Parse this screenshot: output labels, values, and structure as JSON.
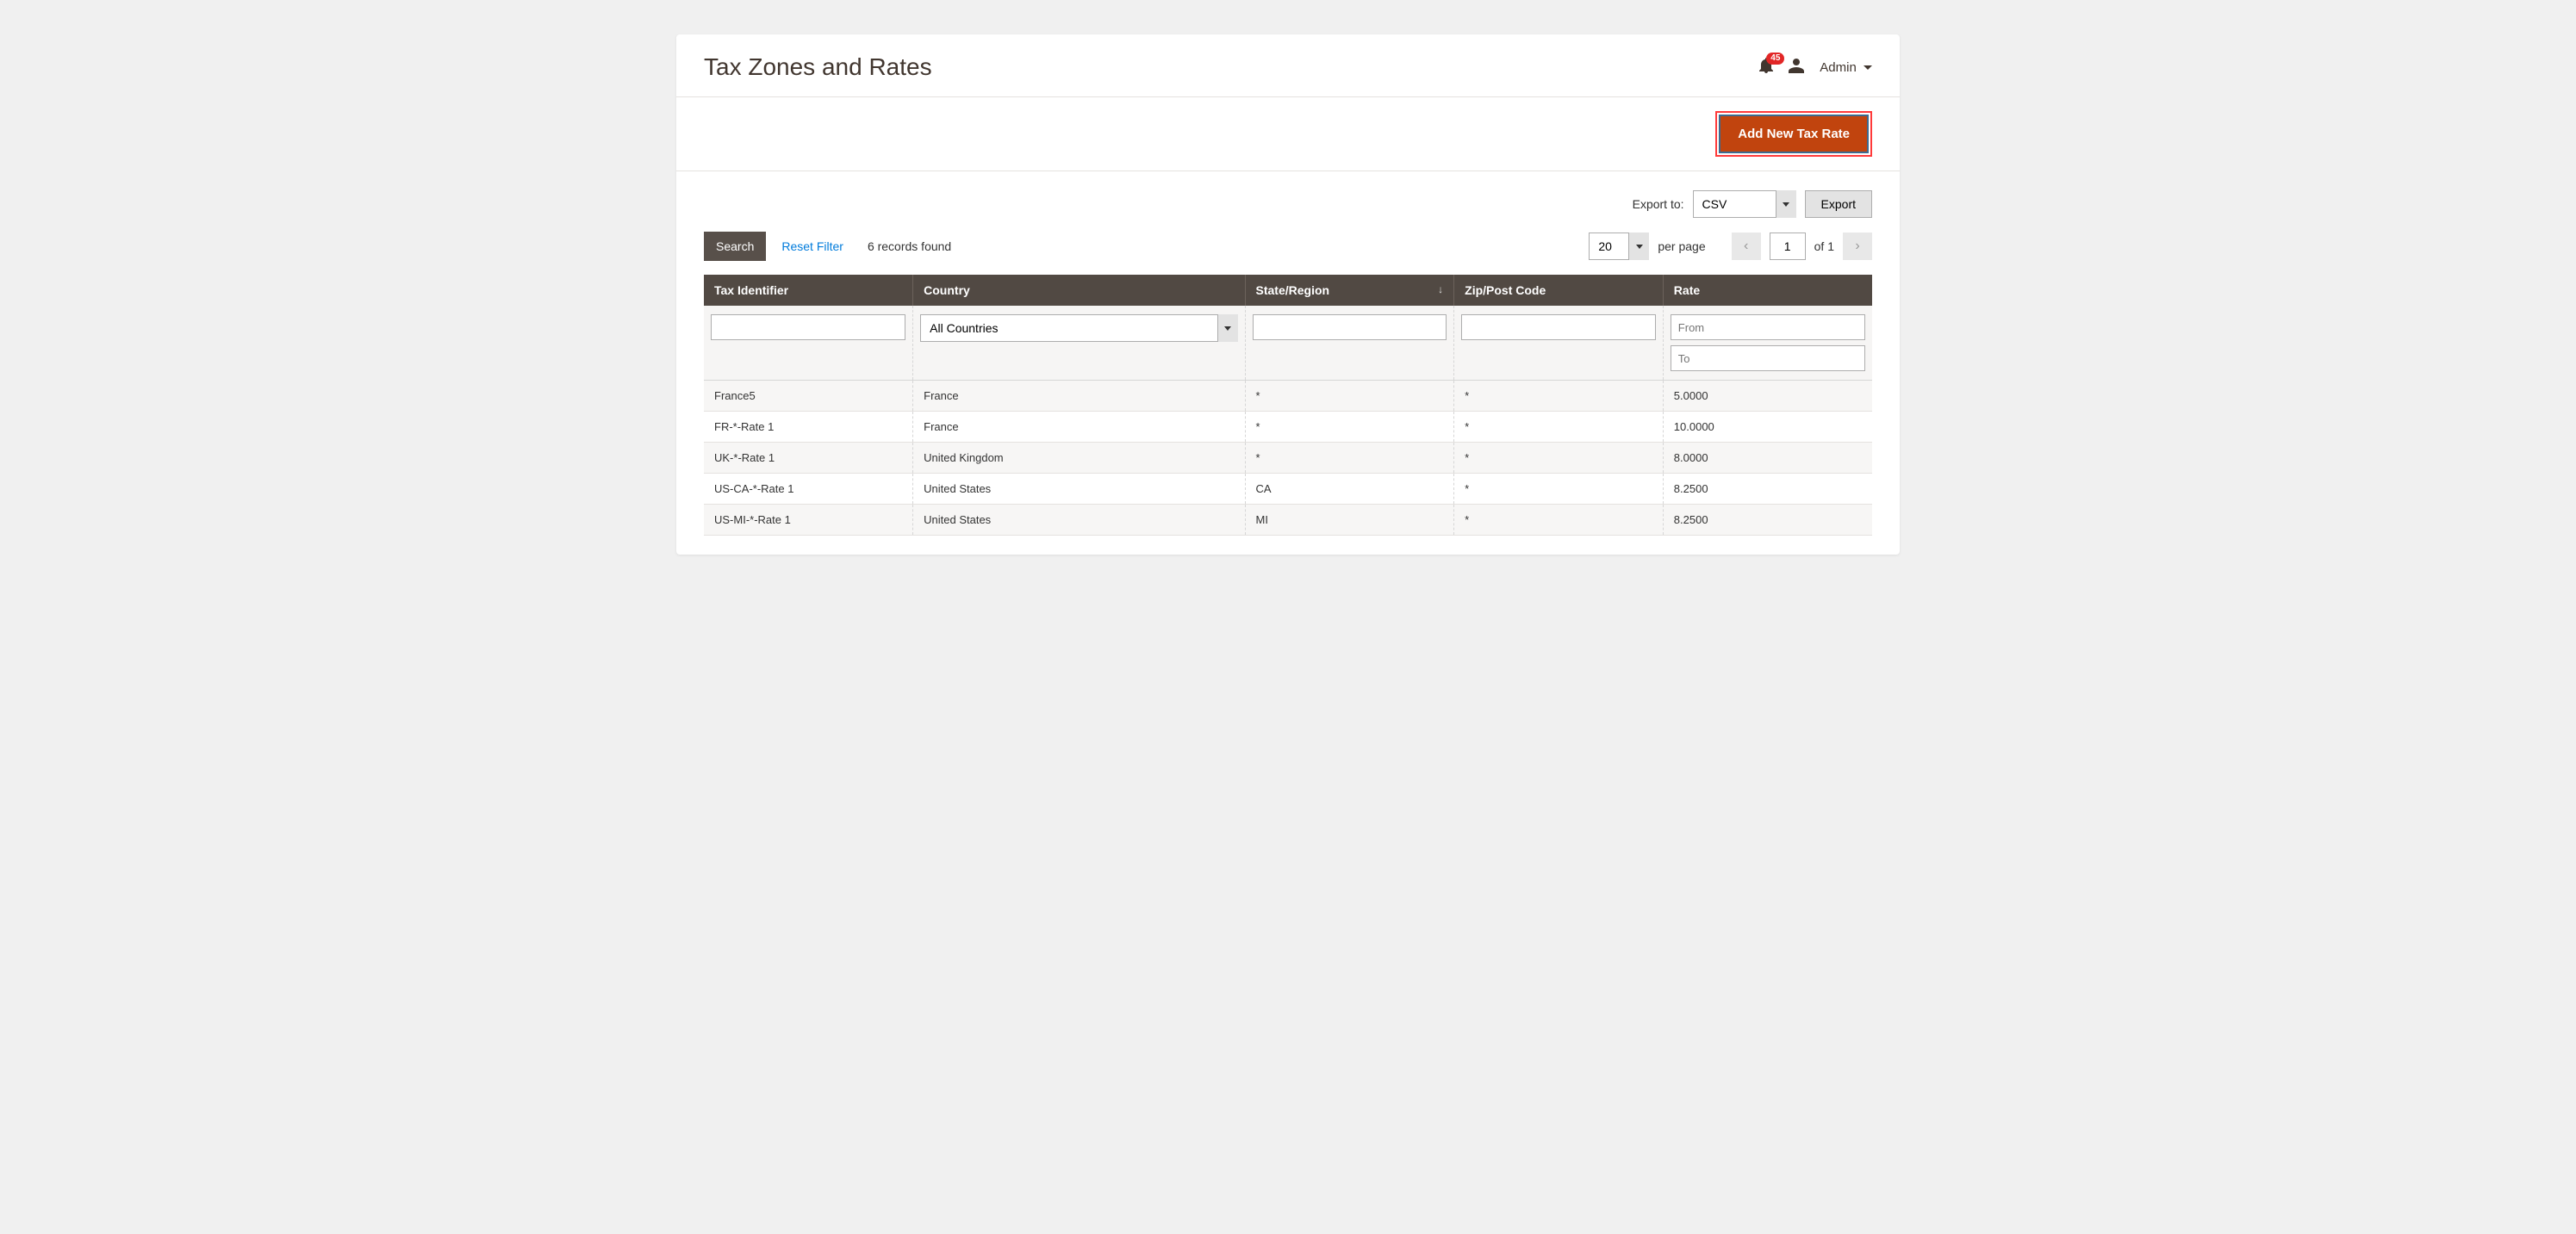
{
  "header": {
    "title": "Tax Zones and Rates",
    "notifications_count": "45",
    "admin_label": "Admin"
  },
  "action_bar": {
    "add_button": "Add New Tax Rate"
  },
  "export": {
    "label": "Export to:",
    "selected": "CSV",
    "button": "Export"
  },
  "controls": {
    "search": "Search",
    "reset": "Reset Filter",
    "records_found": "6 records found",
    "per_page_value": "20",
    "per_page_label": "per page",
    "page_current": "1",
    "page_total_label": "of 1"
  },
  "columns": {
    "tax_identifier": "Tax Identifier",
    "country": "Country",
    "state": "State/Region",
    "zip": "Zip/Post Code",
    "rate": "Rate"
  },
  "filters": {
    "country_selected": "All Countries",
    "rate_from_placeholder": "From",
    "rate_to_placeholder": "To"
  },
  "rows": [
    {
      "id": "France5",
      "country": "France",
      "state": "*",
      "zip": "*",
      "rate": "5.0000"
    },
    {
      "id": "FR-*-Rate 1",
      "country": "France",
      "state": "*",
      "zip": "*",
      "rate": "10.0000"
    },
    {
      "id": "UK-*-Rate 1",
      "country": "United Kingdom",
      "state": "*",
      "zip": "*",
      "rate": "8.0000"
    },
    {
      "id": "US-CA-*-Rate 1",
      "country": "United States",
      "state": "CA",
      "zip": "*",
      "rate": "8.2500"
    },
    {
      "id": "US-MI-*-Rate 1",
      "country": "United States",
      "state": "MI",
      "zip": "*",
      "rate": "8.2500"
    }
  ]
}
